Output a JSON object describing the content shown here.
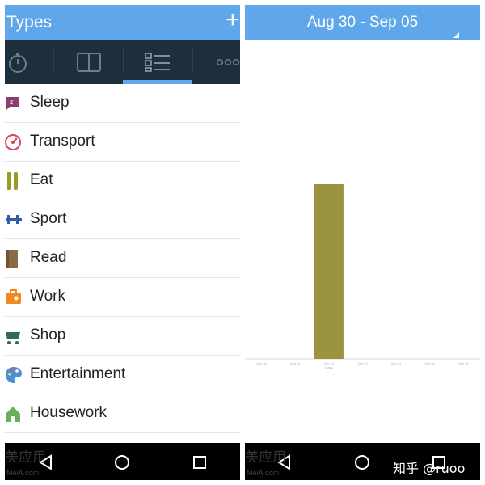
{
  "left": {
    "title": "Types",
    "add_symbol": "+",
    "tabs": [
      "stopwatch-icon",
      "book-icon",
      "list-icon",
      "more-icon"
    ],
    "active_tab": 2,
    "items": [
      {
        "label": "Sleep",
        "icon": "sleep-icon",
        "color": "#8b3f6e"
      },
      {
        "label": "Transport",
        "icon": "speedometer-icon",
        "color": "#d9465a"
      },
      {
        "label": "Eat",
        "icon": "fork-knife-icon",
        "color": "#9a9a2a"
      },
      {
        "label": "Sport",
        "icon": "dumbbell-icon",
        "color": "#2c5fa8"
      },
      {
        "label": "Read",
        "icon": "book-icon",
        "color": "#8b6b45"
      },
      {
        "label": "Work",
        "icon": "briefcase-icon",
        "color": "#f08a1f"
      },
      {
        "label": "Shop",
        "icon": "cart-icon",
        "color": "#2f6b57"
      },
      {
        "label": "Entertainment",
        "icon": "palette-icon",
        "color": "#4a90d9"
      },
      {
        "label": "Housework",
        "icon": "house-icon",
        "color": "#6dae5a"
      }
    ],
    "watermark": "美应用",
    "watermark_sub": "MeiA.com"
  },
  "right": {
    "date_range": "Aug 30 - Sep 05"
  },
  "chart_data": {
    "type": "bar",
    "categories": [
      "Aug 30",
      "Aug 31",
      "Sep 01",
      "Sep 02",
      "Sep 03",
      "Sep 04",
      "Sep 05"
    ],
    "values": [
      0,
      0,
      9,
      0,
      0,
      0,
      0
    ],
    "ylim": [
      0,
      10
    ],
    "bar_color": "#9a9440",
    "xlabel": "Days",
    "grid": false,
    "legend": false
  },
  "credit": "知乎 @ruoo",
  "colors": {
    "accent": "#5fa7ea",
    "tabbar": "#1c2f3a",
    "navbar": "#000000"
  }
}
